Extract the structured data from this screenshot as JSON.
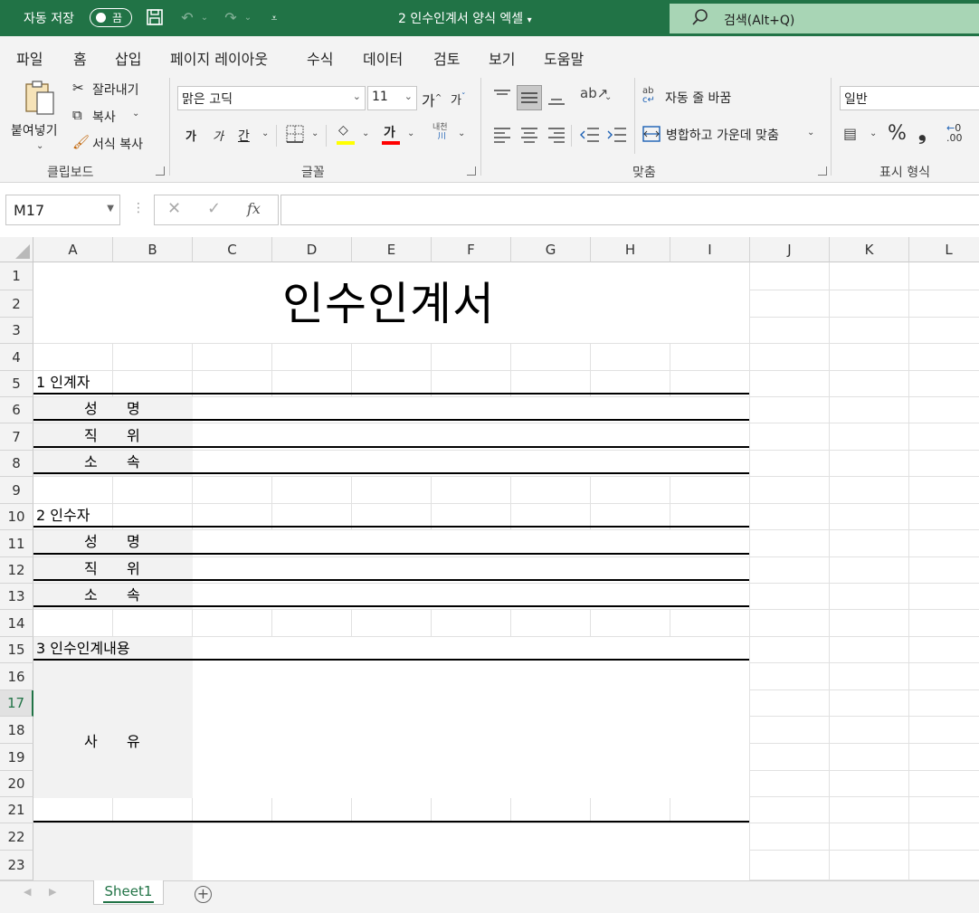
{
  "titlebar": {
    "autosave_label": "자동 저장",
    "autosave_state": "끔",
    "doc_title": "2 인수인계서 양식 엑셀",
    "search_placeholder": "검색(Alt+Q)"
  },
  "menu": {
    "tabs": [
      "파일",
      "홈",
      "삽입",
      "페이지 레이아웃",
      "수식",
      "데이터",
      "검토",
      "보기",
      "도움말"
    ],
    "active": "홈"
  },
  "ribbon": {
    "clipboard": {
      "paste": "붙여넣기",
      "cut": "잘라내기",
      "copy": "복사",
      "format_painter": "서식 복사",
      "group_label": "클립보드"
    },
    "font": {
      "font_name": "맑은 고딕",
      "font_size": "11",
      "grow": "가",
      "shrink": "가",
      "bold": "가",
      "italic": "가",
      "underline": "간",
      "font_color_glyph": "가",
      "phonetic": "내천",
      "group_label": "글꼴",
      "fill_color": "#ffff00",
      "font_color": "#ff0000"
    },
    "alignment": {
      "wrap_text": "자동 줄 바꿈",
      "merge_center": "병합하고 가운데 맞춤",
      "group_label": "맞춤"
    },
    "number": {
      "format": "일반",
      "group_label": "표시 형식"
    }
  },
  "formula_bar": {
    "name_box": "M17",
    "fx": "fx",
    "formula": ""
  },
  "grid": {
    "columns": [
      "A",
      "B",
      "C",
      "D",
      "E",
      "F",
      "G",
      "H",
      "I",
      "J",
      "K",
      "L"
    ],
    "rows": [
      "1",
      "2",
      "3",
      "4",
      "5",
      "6",
      "7",
      "8",
      "9",
      "10",
      "11",
      "12",
      "13",
      "14",
      "15",
      "16",
      "17",
      "18",
      "19",
      "20",
      "21",
      "22",
      "23"
    ],
    "selected_row": "17"
  },
  "sheet": {
    "title": "인수인계서",
    "section1": "1 인계자",
    "section2": "2 인수자",
    "section3": "3 인수인계내용",
    "name_a": "성",
    "name_b": "명",
    "pos_a": "직",
    "pos_b": "위",
    "dept_a": "소",
    "dept_b": "속",
    "name2_a": "성",
    "name2_b": "명",
    "pos2_a": "직",
    "pos2_b": "위",
    "dept2_a": "소",
    "dept2_b": "속",
    "reason_a": "사",
    "reason_b": "유"
  },
  "sheet_tabs": {
    "active_tab": "Sheet1"
  },
  "colors": {
    "accent": "#217346",
    "search_bg": "#a8d5b5",
    "label_shade": "#f2f2f2"
  }
}
